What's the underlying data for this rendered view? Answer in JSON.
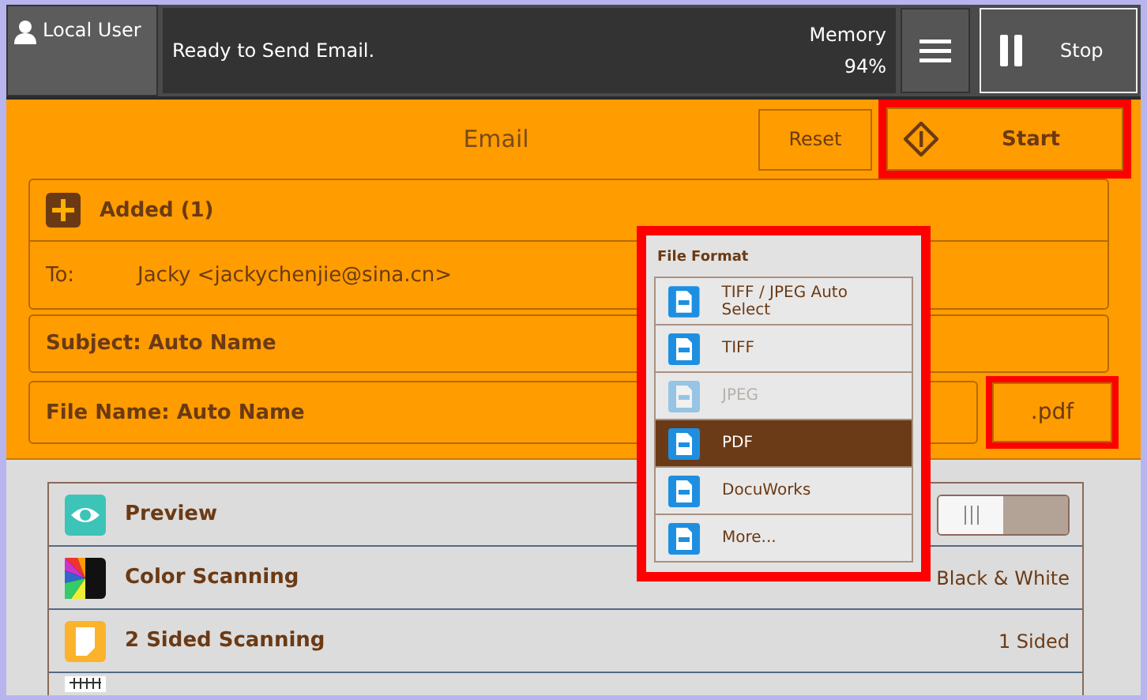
{
  "top_bar": {
    "user": "Local User",
    "status": "Ready to Send Email.",
    "memory_label": "Memory",
    "memory_value": "94%",
    "stop": "Stop"
  },
  "header": {
    "title": "Email",
    "reset": "Reset",
    "start": "Start",
    "start_highlighted": true
  },
  "recipients": {
    "added": "Added (1)",
    "to_label": "To:",
    "to_value": "Jacky <jackychenjie@sina.cn>"
  },
  "subject": "Subject: Auto Name",
  "file_name": {
    "label": "File Name: Auto Name",
    "extension": ".pdf",
    "extension_highlighted": true
  },
  "features": [
    {
      "kind": "toggle",
      "label": "Preview",
      "on": false
    },
    {
      "kind": "value",
      "label": "Color Scanning",
      "value": "Black & White"
    },
    {
      "kind": "value",
      "label": "2 Sided Scanning",
      "value": "1 Sided"
    },
    {
      "kind": "partial"
    }
  ],
  "file_format_menu": {
    "title": "File Format",
    "highlighted": true,
    "items": [
      {
        "label": "TIFF / JPEG Auto Select",
        "selected": false,
        "disabled": false
      },
      {
        "label": "TIFF",
        "selected": false,
        "disabled": false
      },
      {
        "label": "JPEG",
        "selected": false,
        "disabled": true
      },
      {
        "label": "PDF",
        "selected": true,
        "disabled": false
      },
      {
        "label": "DocuWorks",
        "selected": false,
        "disabled": false
      },
      {
        "label": "More...",
        "selected": false,
        "disabled": false
      }
    ]
  }
}
